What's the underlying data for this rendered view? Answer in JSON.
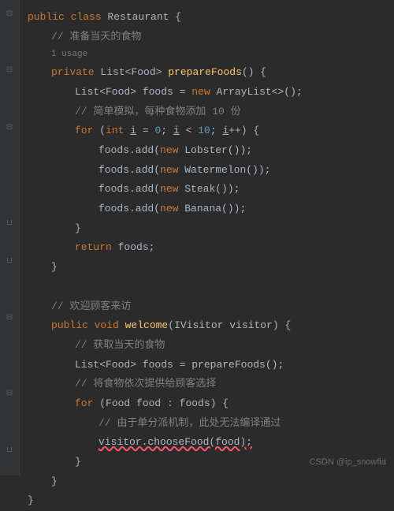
{
  "code": {
    "l1_public": "public ",
    "l1_class": "class ",
    "l1_name": "Restaurant ",
    "l1_brace": "{",
    "c1": "// 准备当天的食物",
    "usage": "1 usage",
    "l3_private": "private ",
    "l3_type": "List<Food> ",
    "l3_method": "prepareFoods",
    "l3_paren": "() {",
    "l4_type": "List<Food> ",
    "l4_var": "foods ",
    "l4_eq": "= ",
    "l4_new": "new ",
    "l4_cls": "ArrayList<>();",
    "c2": "// 简单模拟，每种食物添加 10 份",
    "l6_for": "for ",
    "l6_open": "(",
    "l6_int": "int ",
    "l6_i1": "i",
    "l6_eq": " = ",
    "l6_zero": "0",
    "l6_semi1": "; ",
    "l6_i2": "i",
    "l6_lt": " < ",
    "l6_ten": "10",
    "l6_semi2": "; ",
    "l6_i3": "i",
    "l6_inc": "++) {",
    "l7_foods": "foods.add(",
    "l7_new": "new ",
    "l7_cls": "Lobster());",
    "l8_foods": "foods.add(",
    "l8_new": "new ",
    "l8_cls": "Watermelon());",
    "l9_foods": "foods.add(",
    "l9_new": "new ",
    "l9_cls": "Steak());",
    "l10_foods": "foods.add(",
    "l10_new": "new ",
    "l10_cls": "Banana());",
    "l11_brace": "}",
    "l12_return": "return ",
    "l12_var": "foods;",
    "l13_brace": "}",
    "c3": "// 欢迎顾客来访",
    "l15_public": "public ",
    "l15_void": "void ",
    "l15_method": "welcome",
    "l15_open": "(IVisitor ",
    "l15_param": "visitor",
    "l15_close": ") {",
    "c4": "// 获取当天的食物",
    "l17_type": "List<Food> ",
    "l17_var": "foods ",
    "l17_eq": "= prepareFoods();",
    "c5": "// 将食物依次提供给顾客选择",
    "l19_for": "for ",
    "l19_open": "(Food ",
    "l19_var": "food ",
    "l19_colon": ": foods) {",
    "c6": "// 由于单分派机制，此处无法编译通过",
    "l21_call": "visitor.chooseFood(food);",
    "l22_brace": "}",
    "l23_brace": "}",
    "l24_brace": "}"
  },
  "watermark": "CSDN @ip_snowfla"
}
